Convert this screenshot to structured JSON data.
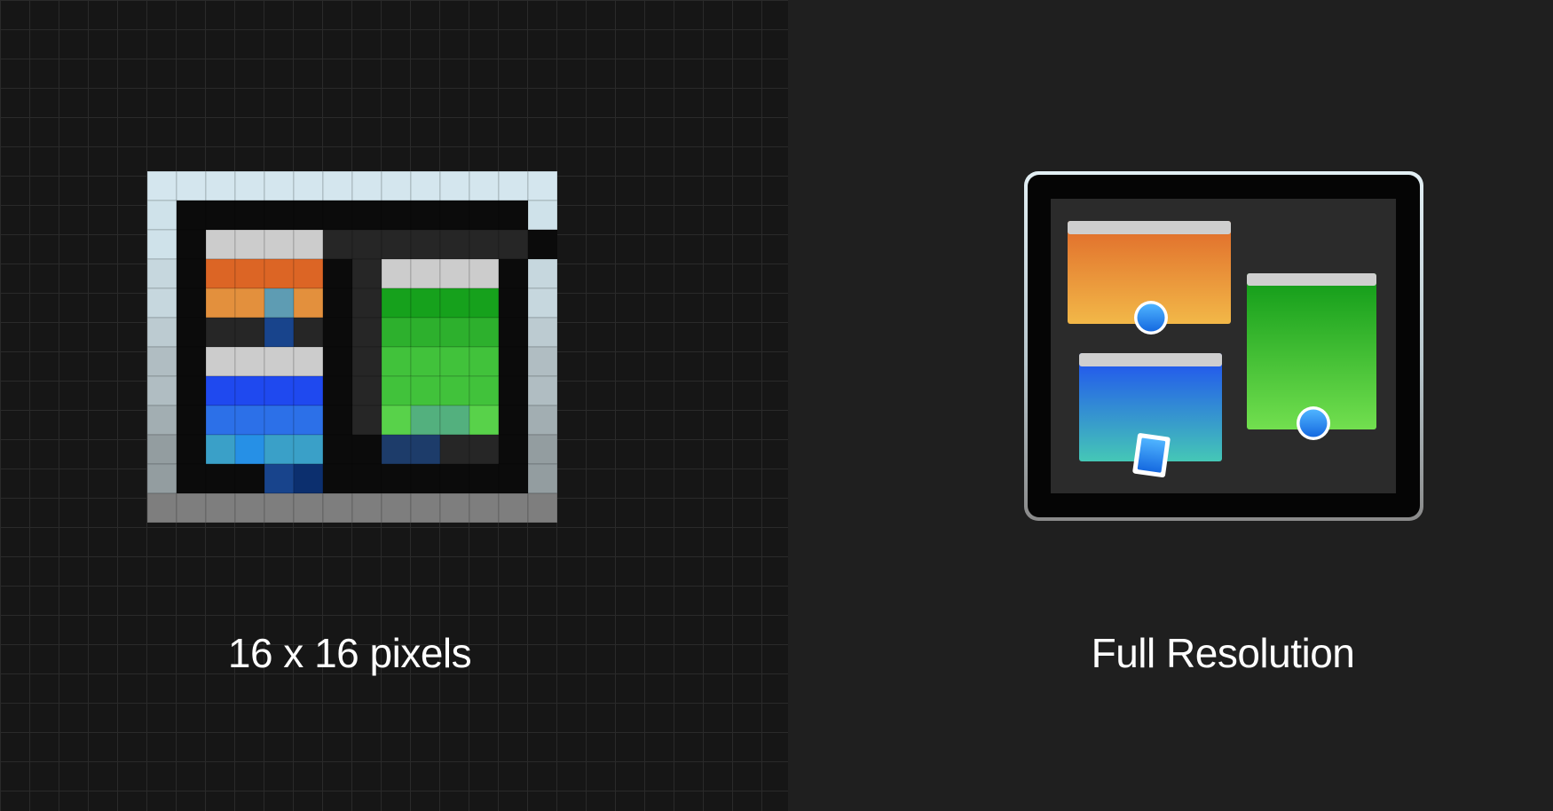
{
  "left_panel": {
    "caption": "16 x 16 pixels",
    "grid_color": "#2a2a2a",
    "background_color": "#161616"
  },
  "right_panel": {
    "caption": "Full Resolution",
    "background_color": "#1f1f1f"
  },
  "icon": {
    "name": "multitasking-windows-icon",
    "colors": {
      "frame_light": "#cfe0e8",
      "frame_dark": "#7c7c7c",
      "screen": "#0a0a0a",
      "inner_screen": "#2a2a2a",
      "title_bar": "#cccccc",
      "orange_top": "#e0672a",
      "orange_bottom": "#f0b147",
      "green_top": "#12a01a",
      "green_bottom": "#6fdc4c",
      "blue_top": "#2152f0",
      "blue_bottom": "#43c3b8",
      "handle": "#1e8cf0"
    }
  }
}
